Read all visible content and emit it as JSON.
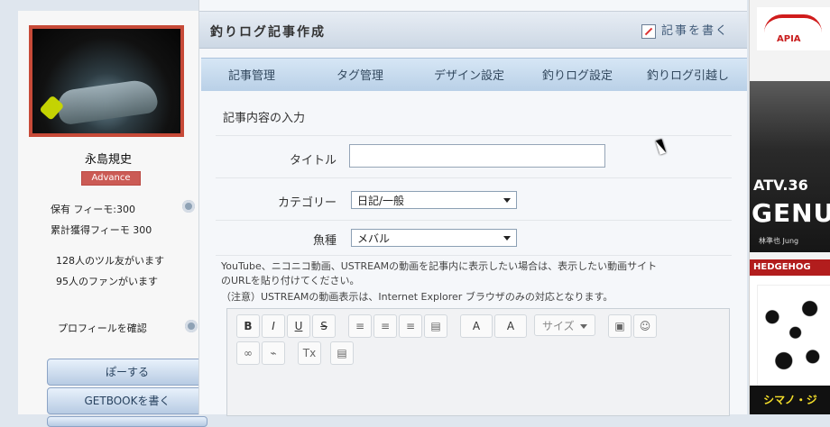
{
  "sidebar": {
    "profile_name": "永島規史",
    "badge": "Advance",
    "stat_1": "保有 フィーモ:300",
    "stat_2": "累計獲得フィーモ 300",
    "friends": "128人のツル友がいます",
    "fans": "95人のファンがいます",
    "profile_link": "プロフィールを確認",
    "buttons": [
      "ぽーする",
      "GETBOOKを書く",
      ""
    ]
  },
  "header": {
    "title": "釣りログ記事作成",
    "write_label": "記事を書く"
  },
  "tabs": [
    "記事管理",
    "タグ管理",
    "デザイン設定",
    "釣りログ設定",
    "釣りログ引越し"
  ],
  "form": {
    "section_title": "記事内容の入力",
    "title_label": "タイトル",
    "title_value": "",
    "category_label": "カテゴリー",
    "category_value": "日記/一般",
    "fish_label": "魚種",
    "fish_value": "メバル",
    "note_1": "YouTube、ニコニコ動画、USTREAMの動画を記事内に表示したい場合は、表示したい動画サイト",
    "note_2": "のURLを貼り付けてください。",
    "note_3": "（注意）USTREAMの動画表示は、Internet Explorer ブラウザのみの対応となります。"
  },
  "toolbar": {
    "bold": "B",
    "italic": "I",
    "underline": "U",
    "strike": "S",
    "size_label": "サイズ",
    "text_color": "A",
    "bg_color": "A"
  },
  "ads": {
    "logo_text": "APIA",
    "photo_line_1": "ATV.36",
    "photo_line_2": "GENU",
    "photo_sub": "林準也 Jung",
    "banner_top": "HEDGEHOG",
    "banner_bottom": "シマノ・ジ"
  }
}
